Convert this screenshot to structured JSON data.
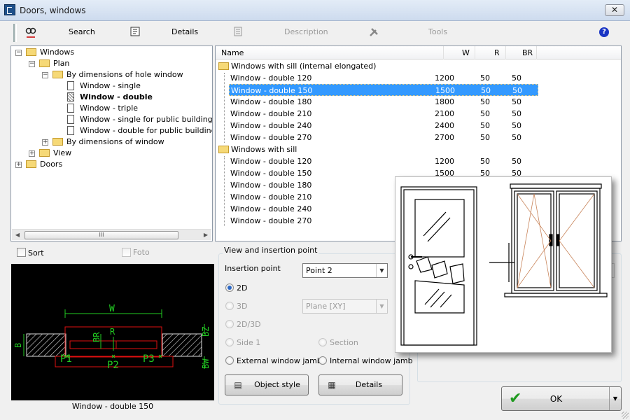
{
  "window": {
    "title": "Doors, windows",
    "close_label": "✕"
  },
  "toolbar": {
    "search": "Search",
    "details": "Details",
    "description": "Description",
    "tools": "Tools",
    "help": "?"
  },
  "tree": {
    "items": [
      {
        "label": "Windows",
        "level": 0,
        "expander": "−",
        "icon": "folder",
        "bold": false
      },
      {
        "label": "Plan",
        "level": 1,
        "expander": "−",
        "icon": "folder",
        "bold": false
      },
      {
        "label": "By dimensions of hole window",
        "level": 2,
        "expander": "−",
        "icon": "folder",
        "bold": false
      },
      {
        "label": "Window - single",
        "level": 3,
        "expander": "",
        "icon": "doc",
        "bold": false
      },
      {
        "label": "Window - double",
        "level": 3,
        "expander": "",
        "icon": "doc-selected",
        "bold": true
      },
      {
        "label": "Window - triple",
        "level": 3,
        "expander": "",
        "icon": "doc",
        "bold": false
      },
      {
        "label": "Window - single for public building const",
        "level": 3,
        "expander": "",
        "icon": "doc",
        "bold": false
      },
      {
        "label": "Window - double for public building cons",
        "level": 3,
        "expander": "",
        "icon": "doc",
        "bold": false
      },
      {
        "label": "By dimensions of window",
        "level": 2,
        "expander": "+",
        "icon": "folder",
        "bold": false
      },
      {
        "label": "View",
        "level": 1,
        "expander": "+",
        "icon": "folder",
        "bold": false
      },
      {
        "label": "Doors",
        "level": 0,
        "expander": "+",
        "icon": "folder",
        "bold": false
      }
    ],
    "scroll_thumb": "III"
  },
  "list": {
    "columns": {
      "name": "Name",
      "w": "W",
      "r": "R",
      "br": "BR"
    },
    "rows": [
      {
        "type": "group",
        "name": "Windows with sill (internal elongated)"
      },
      {
        "type": "item",
        "name": "Window - double 120",
        "w": "1200",
        "r": "50",
        "br": "50"
      },
      {
        "type": "item",
        "name": "Window - double 150",
        "w": "1500",
        "r": "50",
        "br": "50",
        "selected": true
      },
      {
        "type": "item",
        "name": "Window - double 180",
        "w": "1800",
        "r": "50",
        "br": "50"
      },
      {
        "type": "item",
        "name": "Window - double 210",
        "w": "2100",
        "r": "50",
        "br": "50"
      },
      {
        "type": "item",
        "name": "Window - double 240",
        "w": "2400",
        "r": "50",
        "br": "50"
      },
      {
        "type": "item",
        "name": "Window - double 270",
        "w": "2700",
        "r": "50",
        "br": "50"
      },
      {
        "type": "group",
        "name": "Windows with sill"
      },
      {
        "type": "item",
        "name": "Window - double 120",
        "w": "1200",
        "r": "50",
        "br": "50"
      },
      {
        "type": "item",
        "name": "Window - double 150",
        "w": "1500",
        "r": "50",
        "br": "50"
      },
      {
        "type": "item",
        "name": "Window - double 180",
        "w": "",
        "r": "",
        "br": ""
      },
      {
        "type": "item",
        "name": "Window - double 210",
        "w": "",
        "r": "",
        "br": ""
      },
      {
        "type": "item",
        "name": "Window - double 240",
        "w": "",
        "r": "",
        "br": ""
      },
      {
        "type": "item",
        "name": "Window - double 270",
        "w": "",
        "r": "",
        "br": ""
      }
    ]
  },
  "options": {
    "sort": "Sort",
    "foto": "Foto"
  },
  "preview": {
    "caption": "Window - double 150",
    "labels": {
      "w": "W",
      "r": "R",
      "br": "BR",
      "b": "B",
      "bz": "BZ",
      "bw": "BW",
      "p1": "P1",
      "p2": "P2",
      "p3": "P3"
    }
  },
  "insertion": {
    "group_title": "View and insertion point",
    "insertion_point_label": "Insertion point",
    "insertion_point_value": "Point 2",
    "plane_value": "Plane  [XY]",
    "radios": {
      "r2d": "2D",
      "r3d": "3D",
      "r2d3d": "2D/3D",
      "side1": "Side 1",
      "section": "Section",
      "ext_jamb": "External window jamb",
      "int_jamb": "Internal window jamb"
    },
    "object_style": "Object style",
    "details": "Details"
  },
  "ok": {
    "label": "OK"
  },
  "colors": {
    "selection": "#3399ff",
    "cad_green": "#22cc22",
    "cad_red": "#e01010",
    "accent": "#1d4f8a"
  }
}
